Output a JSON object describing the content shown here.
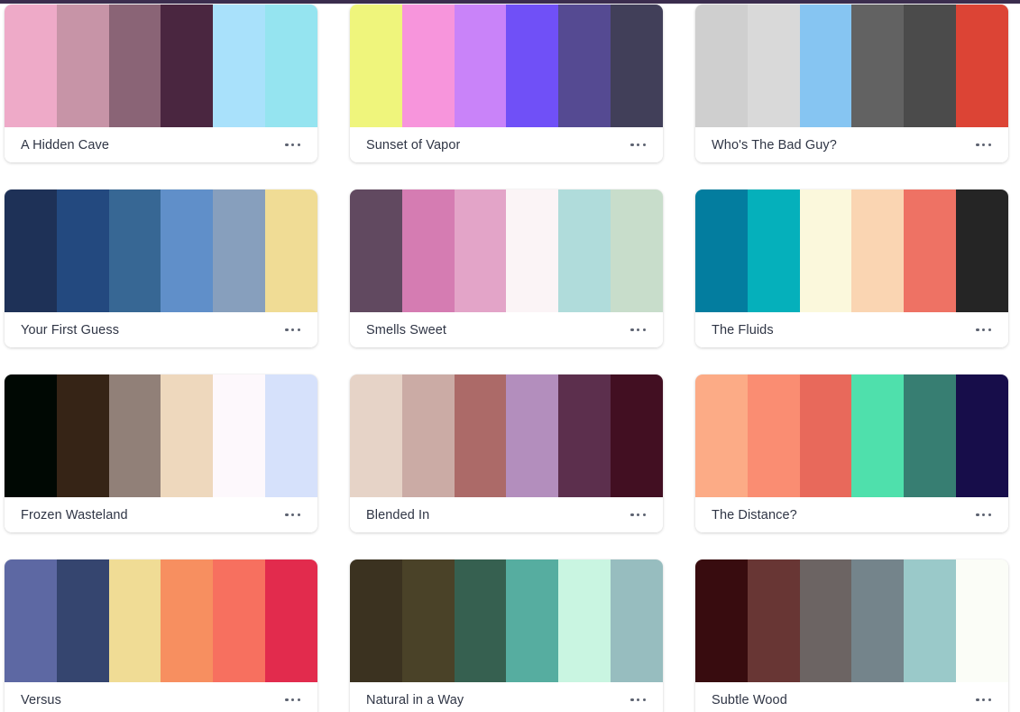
{
  "page": {
    "background_color": "#ffffff",
    "top_bar_color": "#3b2d4e",
    "title_color": "#2f3545",
    "menu_dot_color": "#5c6270",
    "card_background": "#ffffff"
  },
  "more_menu_label": "More options",
  "palettes": [
    {
      "name": "A Hidden Cave",
      "colors": [
        "#eeaac8",
        "#c794a7",
        "#8a6476",
        "#4a2640",
        "#a9e1fb",
        "#95e4f0"
      ]
    },
    {
      "name": "Sunset of Vapor",
      "colors": [
        "#eff57c",
        "#f795dc",
        "#c983f9",
        "#7050f7",
        "#554a92",
        "#413f59"
      ]
    },
    {
      "name": "Who's The Bad Guy?",
      "colors": [
        "#cfcfcf",
        "#d9d9d9",
        "#86c5f2",
        "#626262",
        "#4b4b4b",
        "#dc4435"
      ]
    },
    {
      "name": "Your First Guess",
      "colors": [
        "#1e3157",
        "#23497f",
        "#376794",
        "#608fc9",
        "#879fbd",
        "#f0dc95"
      ]
    },
    {
      "name": "Smells Sweet",
      "colors": [
        "#614960",
        "#d57cb2",
        "#e3a4c8",
        "#fbf4f6",
        "#b0dcdb",
        "#c8ddcb"
      ]
    },
    {
      "name": "The Fluids",
      "colors": [
        "#037d9f",
        "#05b0bb",
        "#fbf8dc",
        "#fad5b2",
        "#ee7264",
        "#252525"
      ]
    },
    {
      "name": "Frozen Wasteland",
      "colors": [
        "#000803",
        "#362416",
        "#918078",
        "#eed8bd",
        "#fdf8fc",
        "#d6e1fb"
      ]
    },
    {
      "name": "Blended In",
      "colors": [
        "#e6d3c7",
        "#cbaba5",
        "#ac6a68",
        "#b38ebd",
        "#5c2f4d",
        "#420f22"
      ]
    },
    {
      "name": "The Distance?",
      "colors": [
        "#fcab86",
        "#fa8d72",
        "#e8695b",
        "#4fe0ac",
        "#377e72",
        "#170d4a"
      ]
    },
    {
      "name": "Versus",
      "colors": [
        "#5d68a3",
        "#35456f",
        "#f0dc95",
        "#f78f60",
        "#f7705f",
        "#e22b4d"
      ]
    },
    {
      "name": "Natural in a Way",
      "colors": [
        "#3b3220",
        "#4a4228",
        "#366050",
        "#56ada0",
        "#c9f5e1",
        "#97bdbf"
      ]
    },
    {
      "name": "Subtle Wood",
      "colors": [
        "#380c0f",
        "#683634",
        "#6c6463",
        "#74848b",
        "#9ac9c9",
        "#fbfdf7"
      ]
    }
  ]
}
